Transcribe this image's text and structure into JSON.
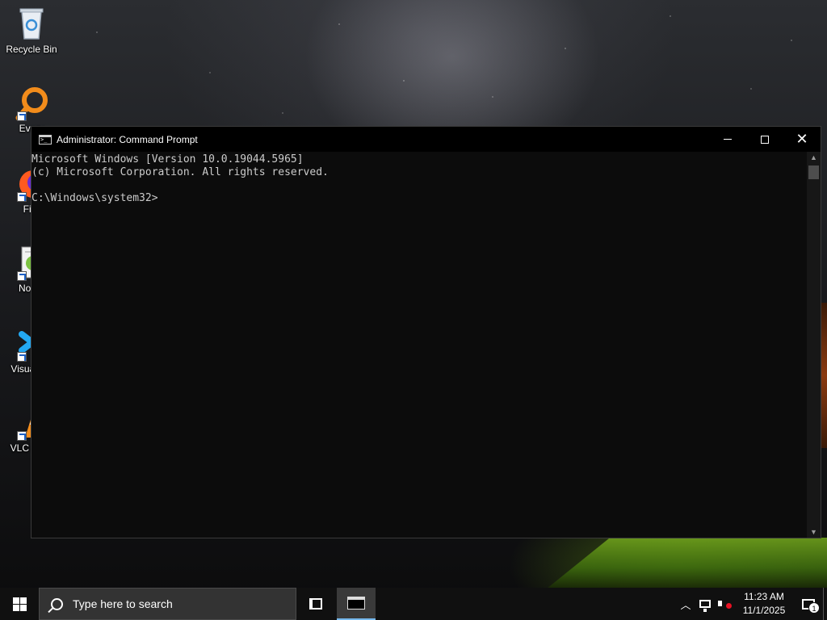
{
  "desktop": {
    "icons": [
      {
        "name": "recycle-bin",
        "label": "Recycle Bin"
      },
      {
        "name": "everything",
        "label": "Every"
      },
      {
        "name": "firefox",
        "label": "Fire"
      },
      {
        "name": "notepad",
        "label": "Notep"
      },
      {
        "name": "visual-studio-code",
        "label": "Visual Co"
      },
      {
        "name": "vlc",
        "label": "VLC n pla"
      }
    ]
  },
  "window": {
    "title": "Administrator: Command Prompt",
    "console_lines": [
      "Microsoft Windows [Version 10.0.19044.5965]",
      "(c) Microsoft Corporation. All rights reserved.",
      "",
      "C:\\Windows\\system32>"
    ]
  },
  "taskbar": {
    "search_placeholder": "Type here to search",
    "clock_time": "11:23 AM",
    "clock_date": "11/1/2025",
    "notification_count": "1"
  },
  "colors": {
    "console_bg": "#0c0c0c",
    "console_text": "#cccccc",
    "taskbar_bg": "#101010",
    "active_task_underline": "#76b9ed"
  }
}
